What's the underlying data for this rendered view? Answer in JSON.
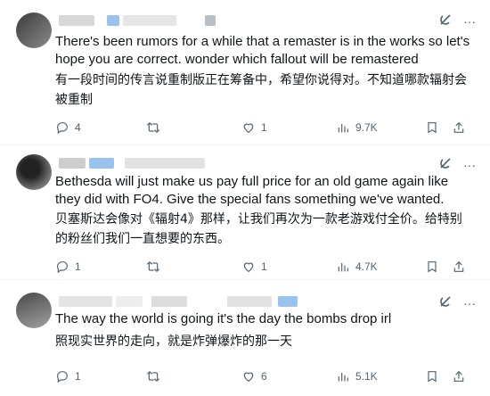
{
  "posts": [
    {
      "en_text": "There's been rumors for a while that a remaster is in the works so let's hope you are correct. wonder which fallout will be remastered",
      "zh_text": "有一段时间的传言说重制版正在筹备中，希望你说得对。不知道哪款辐射会被重制",
      "replies": "4",
      "retweets": "",
      "likes": "1",
      "views": "9.7K",
      "more_label": "···"
    },
    {
      "en_text": "Bethesda will just make us pay full price for an old game again like they did with FO4. Give the special fans something we've wanted.",
      "zh_text": "贝塞斯达会像对《辐射4》那样，让我们再次为一款老游戏付全价。给特别的粉丝们我们一直想要的东西。",
      "replies": "1",
      "retweets": "",
      "likes": "1",
      "views": "4.7K",
      "more_label": "···"
    },
    {
      "en_text": "The way the world is going it's the day the bombs drop irl",
      "zh_text": "照现实世界的走向，就是炸弹爆炸的那一天",
      "replies": "1",
      "retweets": "",
      "likes": "6",
      "views": "5.1K",
      "more_label": "···"
    }
  ],
  "colors": {
    "text": "#0f1419",
    "muted": "#536471",
    "divider": "#eff3f4"
  },
  "icons": [
    "grok-icon",
    "more-icon",
    "reply-icon",
    "retweet-icon",
    "like-icon",
    "views-icon",
    "bookmark-icon",
    "share-icon"
  ]
}
